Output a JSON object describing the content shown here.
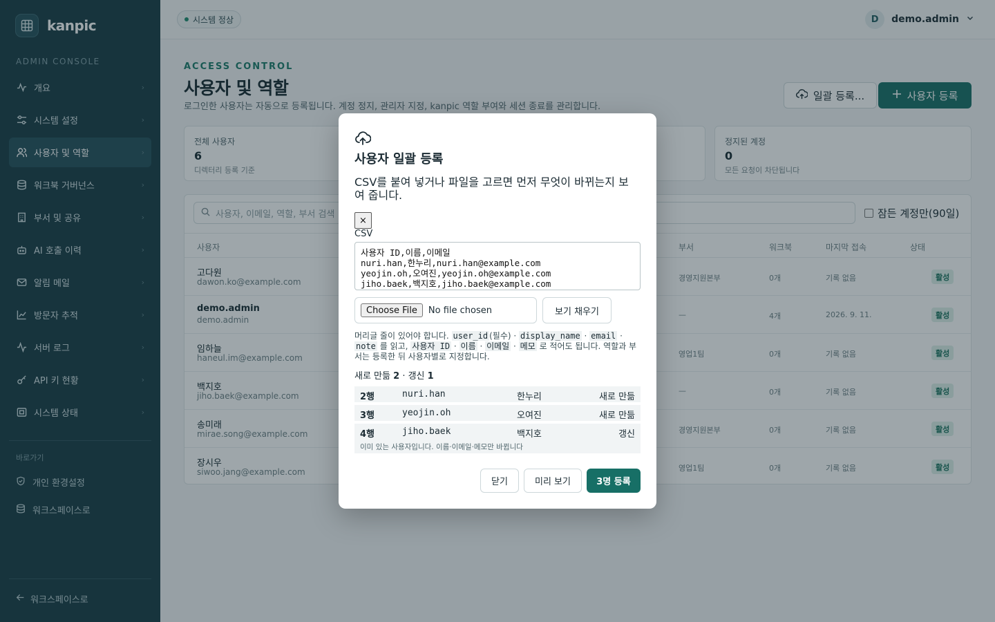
{
  "sidebar": {
    "brand": "kanpic",
    "section_label": "ADMIN CONSOLE",
    "items": [
      {
        "label": "개요",
        "icon": "activity-icon"
      },
      {
        "label": "시스템 설정",
        "icon": "sliders-icon"
      },
      {
        "label": "사용자 및 역할",
        "icon": "users-icon"
      },
      {
        "label": "워크북 거버넌스",
        "icon": "database-icon"
      },
      {
        "label": "부서 및 공유",
        "icon": "building-icon"
      },
      {
        "label": "AI 호출 이력",
        "icon": "bot-icon"
      },
      {
        "label": "알림 메일",
        "icon": "mail-icon"
      },
      {
        "label": "방문자 추적",
        "icon": "chart-line-icon"
      },
      {
        "label": "서버 로그",
        "icon": "pulse-icon"
      },
      {
        "label": "API 키 현황",
        "icon": "key-icon"
      },
      {
        "label": "시스템 상태",
        "icon": "monitor-icon"
      }
    ],
    "shortcuts_label": "바로가기",
    "shortcuts": [
      {
        "label": "개인 환경설정",
        "icon": "shield-icon"
      },
      {
        "label": "워크스페이스로",
        "icon": "database-icon"
      }
    ],
    "back_label": "워크스페이스로"
  },
  "topbar": {
    "status": "시스템 정상",
    "avatar_initial": "D",
    "user_name": "demo.admin"
  },
  "page": {
    "eyebrow": "ACCESS CONTROL",
    "title": "사용자 및 역할",
    "description": "로그인한 사용자는 자동으로 등록됩니다. 계정 정지, 관리자 지정, kanpic 역할 부여와 세션 종료를 관리합니다.",
    "bulk_button": "일괄 등록...",
    "add_button": "사용자 등록"
  },
  "stats": [
    {
      "label": "전체 사용자",
      "value": "6",
      "sub": "디렉터리 등록 기준"
    },
    {
      "label": "정지된 계정",
      "value": "0",
      "sub": "모든 요청이 차단됩니다"
    }
  ],
  "table": {
    "search_placeholder": "사용자, 이메일, 역할, 부서 검색",
    "inactive_filter": "잠든 계정만(90일)",
    "headers": {
      "user": "사용자",
      "dept": "부서",
      "workbook": "워크북",
      "last": "마지막 접속",
      "status": "상태"
    },
    "rows": [
      {
        "name": "고다원",
        "email": "dawon.ko@example.com",
        "dept": "경영지원본부",
        "workbook": "0개",
        "last": "기록 없음",
        "status": "활성"
      },
      {
        "name": "demo.admin",
        "email": "demo.admin",
        "dept": "—",
        "workbook": "4개",
        "last": "2026. 9. 11.",
        "status": "활성"
      },
      {
        "name": "임하늘",
        "email": "haneul.im@example.com",
        "dept": "영업1팀",
        "workbook": "0개",
        "last": "기록 없음",
        "status": "활성"
      },
      {
        "name": "백지호",
        "email": "jiho.baek@example.com",
        "dept": "—",
        "workbook": "0개",
        "last": "기록 없음",
        "status": "활성"
      },
      {
        "name": "송미래",
        "email": "mirae.song@example.com",
        "dept": "경영지원본부",
        "workbook": "0개",
        "last": "기록 없음",
        "status": "활성"
      },
      {
        "name": "장시우",
        "email": "siwoo.jang@example.com",
        "dept": "영업1팀",
        "workbook": "0개",
        "last": "기록 없음",
        "status": "활성"
      }
    ]
  },
  "modal": {
    "title": "사용자 일괄 등록",
    "description": "CSV를 붙여 넣거나 파일을 고르면 먼저 무엇이 바뀌는지 보여 줍니다.",
    "close_glyph": "×",
    "csv_label": "CSV",
    "csv_value": "사용자 ID,이름,이메일\nnuri.han,한누리,nuri.han@example.com\nyeojin.oh,오여진,yeojin.oh@example.com\njiho.baek,백지호,jiho.baek@example.com",
    "choose_file": "Choose File",
    "no_file": "No file chosen",
    "fill_button": "보기 채우기",
    "help": {
      "t1": "머리글 줄이 있어야 합니다. ",
      "c1": "user_id",
      "t2": "(필수) · ",
      "c2": "display_name",
      "t3": " · ",
      "c3": "email",
      "t4": " · ",
      "c4": "note",
      "t5": " 를 읽고, ",
      "c5": "사용자 ID",
      "t6": " · ",
      "c6": "이름",
      "t7": " · ",
      "c7": "이메일",
      "t8": " · ",
      "c8": "메모",
      "t9": " 로 적어도 됩니다. 역할과 부서는 등록한 뒤 사용자별로 지정합니다."
    },
    "summary": {
      "new_label": "새로 만듦",
      "new_count": "2",
      "sep": "·",
      "update_label": "갱신",
      "update_count": "1"
    },
    "preview": [
      {
        "row": "2행",
        "id": "nuri.han",
        "name": "한누리",
        "action": "새로 만듦",
        "note": ""
      },
      {
        "row": "3행",
        "id": "yeojin.oh",
        "name": "오여진",
        "action": "새로 만듦",
        "note": ""
      },
      {
        "row": "4행",
        "id": "jiho.baek",
        "name": "백지호",
        "action": "갱신",
        "note": "이미 있는 사용자입니다. 이름·이메일·메모만 바뀝니다"
      }
    ],
    "buttons": {
      "close": "닫기",
      "preview": "미리 보기",
      "submit": "3명 등록"
    }
  }
}
